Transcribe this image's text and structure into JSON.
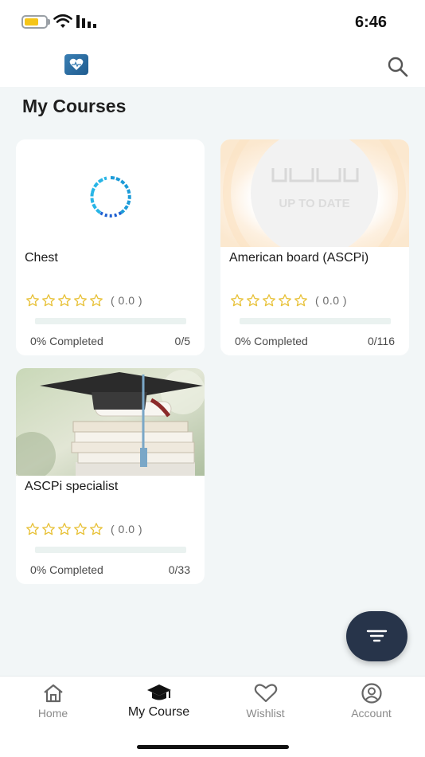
{
  "status_bar": {
    "time": "6:46",
    "battery_icon": "battery-icon",
    "wifi_icon": "wifi-icon",
    "signal_icon": "signal-icon"
  },
  "header": {
    "logo_icon": "heart-logo-icon",
    "search_icon": "search-icon"
  },
  "page": {
    "title": "My Courses"
  },
  "courses": [
    {
      "title": "Chest",
      "rating": "( 0.0 )",
      "rating_value": 0,
      "stars": 5,
      "progress": 0,
      "completed_label": "0% Completed",
      "count": "0/5",
      "media": "loading-spinner"
    },
    {
      "title": "American board (ASCPi)",
      "rating": "( 0.0 )",
      "rating_value": 0,
      "stars": 5,
      "progress": 0,
      "completed_label": "0% Completed",
      "count": "0/116",
      "media": "up-to-date-logo",
      "media_text": "UP TO DATE"
    },
    {
      "title": "ASCPi specialist",
      "rating": "( 0.0 )",
      "rating_value": 0,
      "stars": 5,
      "progress": 0,
      "completed_label": "0% Completed",
      "count": "0/33",
      "media": "graduation-books-image"
    }
  ],
  "fab": {
    "icon": "filter-icon"
  },
  "bottom_nav": {
    "items": [
      {
        "label": "Home",
        "icon": "home-icon",
        "active": false
      },
      {
        "label": "My Course",
        "icon": "graduation-cap-icon",
        "active": true
      },
      {
        "label": "Wishlist",
        "icon": "heart-icon",
        "active": false
      },
      {
        "label": "Account",
        "icon": "account-icon",
        "active": false
      }
    ]
  },
  "colors": {
    "accent": "#27344a",
    "star": "#e8c23a",
    "background": "#f2f6f7",
    "progress_track": "#eaf2f0"
  }
}
